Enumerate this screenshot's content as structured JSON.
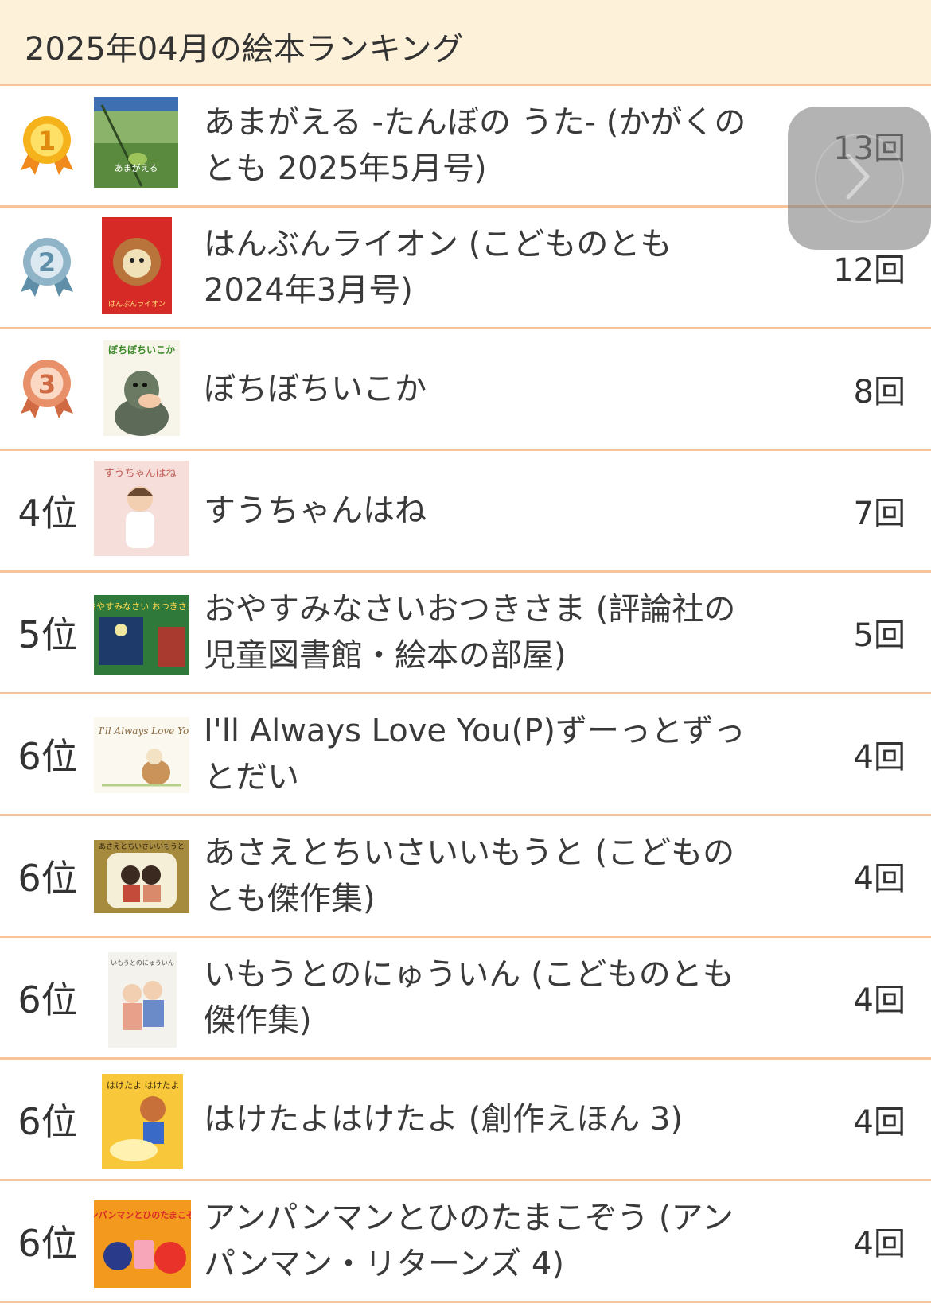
{
  "header": {
    "title": "2025年04月の絵本ランキング"
  },
  "rows": [
    {
      "rank": "1",
      "title_line1": "あまがえる -たんぼの うた- (かがくの",
      "title_line2": "とも 2025年5月号)",
      "count": "13回",
      "cover_text": "あまがえる"
    },
    {
      "rank": "2",
      "title_line1": "はんぶんライオン (こどものとも",
      "title_line2": "2024年3月号)",
      "count": "12回",
      "cover_text": "はんぶんライオン"
    },
    {
      "rank": "3",
      "title_line1": "ぼちぼちいこか",
      "title_line2": "",
      "count": "8回",
      "cover_text": "ぼちぼちいこか"
    },
    {
      "rank": "4位",
      "title_line1": "すうちゃんはね",
      "title_line2": "",
      "count": "7回",
      "cover_text": "すうちゃんはね"
    },
    {
      "rank": "5位",
      "title_line1": "おやすみなさいおつきさま (評論社の",
      "title_line2": "児童図書館・絵本の部屋)",
      "count": "5回",
      "cover_text": "おやすみなさい おつきさま"
    },
    {
      "rank": "6位",
      "title_line1": "I'll Always Love You(P)ずーっとずっ",
      "title_line2": "とだい",
      "count": "4回",
      "cover_text": "I'll Always Love You"
    },
    {
      "rank": "6位",
      "title_line1": "あさえとちいさいいもうと (こどもの",
      "title_line2": "とも傑作集)",
      "count": "4回",
      "cover_text": "あさえとちいさいいもうと"
    },
    {
      "rank": "6位",
      "title_line1": "いもうとのにゅういん (こどものとも",
      "title_line2": "傑作集)",
      "count": "4回",
      "cover_text": "いもうとのにゅういん"
    },
    {
      "rank": "6位",
      "title_line1": "はけたよはけたよ (創作えほん 3)",
      "title_line2": "",
      "count": "4回",
      "cover_text": "はけたよ はけたよ"
    },
    {
      "rank": "6位",
      "title_line1": "アンパンマンとひのたまこぞう (アン",
      "title_line2": "パンマン・リターンズ 4)",
      "count": "4回",
      "cover_text": "アンパンマンとひのたまこぞう"
    }
  ],
  "medal_colors": {
    "gold": "#f5b21b",
    "silver": "#8fb3c7",
    "bronze": "#e8906a"
  },
  "floating_button": {
    "icon": "chevron-right-icon"
  }
}
